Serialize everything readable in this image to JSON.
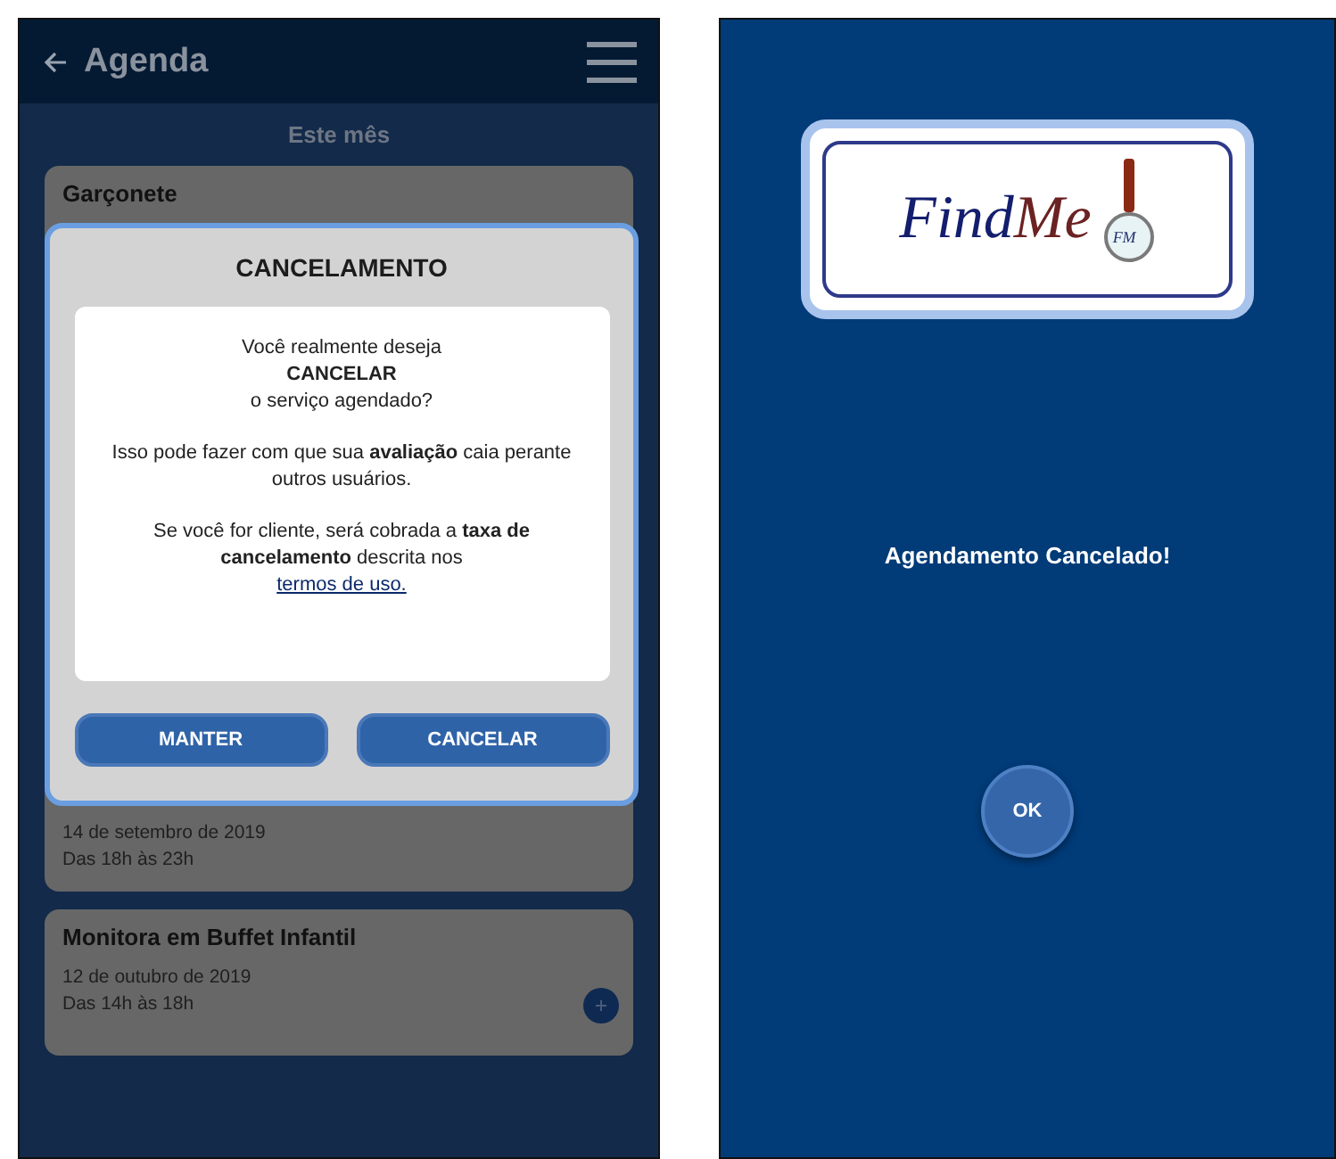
{
  "agenda_screen": {
    "header": {
      "title": "Agenda"
    },
    "section_title": "Este mês",
    "cards": [
      {
        "title": "Garçonete"
      },
      {
        "date": "14 de setembro de 2019",
        "time": "Das 18h às 23h"
      },
      {
        "title": "Monitora em Buffet Infantil",
        "date": "12 de outubro de 2019",
        "time": "Das 14h às 18h",
        "add_button": true
      }
    ],
    "dialog": {
      "title": "CANCELAMENTO",
      "paragraphs": [
        "Você realmente deseja",
        "CANCELAR",
        "o serviço agendado?"
      ],
      "warning": "Isso pode fazer com que sua **avaliação** caia perante outros usuários.",
      "fee_notice": "Se você for cliente, será cobrada a **taxa de cancelamento** descrita nos",
      "terms_link": "termos de uso.",
      "buttons": [
        {
          "label": "MANTER"
        },
        {
          "label": "CANCELAR"
        }
      ]
    }
  },
  "confirmation_screen": {
    "logo": {
      "find": "Find",
      "me": "Me",
      "badge": "FM"
    },
    "message": "Agendamento Cancelado!",
    "ok_button": "OK"
  }
}
